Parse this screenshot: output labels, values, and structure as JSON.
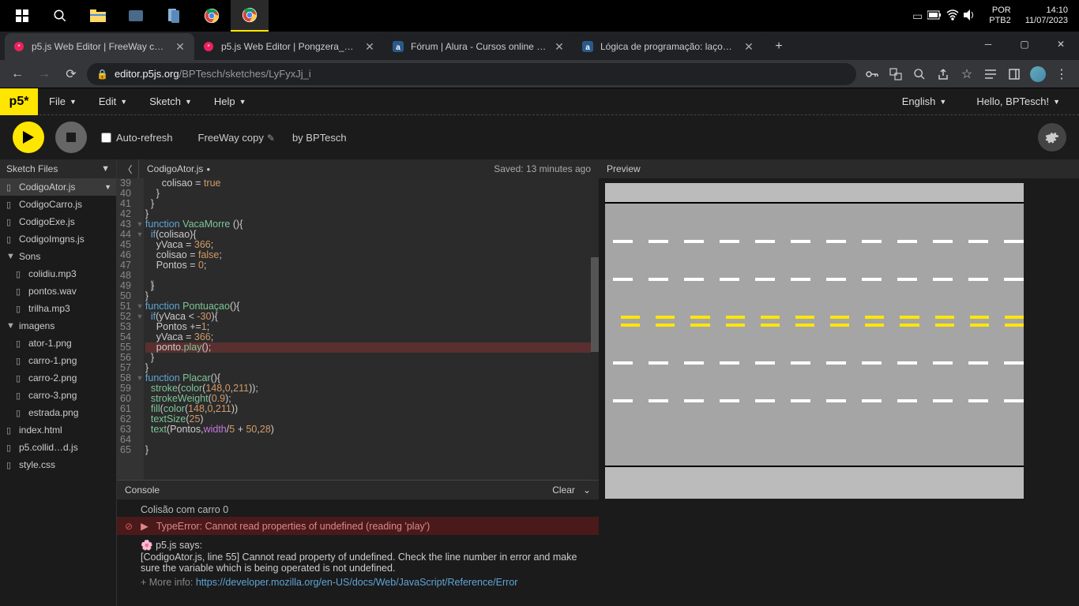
{
  "taskbar": {
    "lang1": "POR",
    "lang2": "PTB2",
    "time": "14:10",
    "date": "11/07/2023"
  },
  "tabs": [
    {
      "title": "p5.js Web Editor | FreeWay copy",
      "active": true
    },
    {
      "title": "p5.js Web Editor | Pongzera_Expe",
      "active": false
    },
    {
      "title": "Fórum | Alura - Cursos online de",
      "active": false
    },
    {
      "title": "Lógica de programação: laços e l",
      "active": false
    }
  ],
  "address": {
    "domain": "editor.p5js.org",
    "path": "/BPTesch/sketches/LyFyxJj_i"
  },
  "menu": {
    "file": "File",
    "edit": "Edit",
    "sketch": "Sketch",
    "help": "Help",
    "logo": "p5*",
    "english": "English",
    "hello": "Hello, BPTesch!"
  },
  "toolbar": {
    "auto_refresh": "Auto-refresh",
    "sketch_name": "FreeWay copy",
    "by": "by BPTesch"
  },
  "sidebar": {
    "header": "Sketch Files",
    "items": [
      {
        "name": "CodigoAtor.js",
        "icon": "▯",
        "indent": 0,
        "active": true,
        "arrow": true
      },
      {
        "name": "CodigoCarro.js",
        "icon": "▯",
        "indent": 0
      },
      {
        "name": "CodigoExe.js",
        "icon": "▯",
        "indent": 0
      },
      {
        "name": "CodigoImgns.js",
        "icon": "▯",
        "indent": 0
      },
      {
        "name": "Sons",
        "icon": "▼",
        "indent": 0
      },
      {
        "name": "colidiu.mp3",
        "icon": "▯",
        "indent": 1
      },
      {
        "name": "pontos.wav",
        "icon": "▯",
        "indent": 1
      },
      {
        "name": "trilha.mp3",
        "icon": "▯",
        "indent": 1
      },
      {
        "name": "imagens",
        "icon": "▼",
        "indent": 0
      },
      {
        "name": "ator-1.png",
        "icon": "▯",
        "indent": 1
      },
      {
        "name": "carro-1.png",
        "icon": "▯",
        "indent": 1
      },
      {
        "name": "carro-2.png",
        "icon": "▯",
        "indent": 1
      },
      {
        "name": "carro-3.png",
        "icon": "▯",
        "indent": 1
      },
      {
        "name": "estrada.png",
        "icon": "▯",
        "indent": 1
      },
      {
        "name": "index.html",
        "icon": "▯",
        "indent": 0
      },
      {
        "name": "p5.collid…d.js",
        "icon": "▯",
        "indent": 0
      },
      {
        "name": "style.css",
        "icon": "▯",
        "indent": 0
      }
    ]
  },
  "editor": {
    "filename": "CodigoAtor.js",
    "modified": "●",
    "saved": "Saved: 13 minutes ago",
    "first_line": 39,
    "lines": [
      {
        "html": "      colisao <span class='op'>=</span> <span class='bool'>true</span>"
      },
      {
        "html": "    }"
      },
      {
        "html": "  }"
      },
      {
        "html": "}"
      },
      {
        "html": "<span class='kw'>function</span> <span class='fn'>VacaMorre</span> (){",
        "fold": "▼"
      },
      {
        "html": "  <span class='kw'>if</span>(colisao){",
        "fold": "▼"
      },
      {
        "html": "    yVaca <span class='op'>=</span> <span class='num'>366</span>;"
      },
      {
        "html": "    colisao <span class='op'>=</span> <span class='bool'>false</span>;"
      },
      {
        "html": "    Pontos <span class='op'>=</span> <span class='num'>0</span>;"
      },
      {
        "html": ""
      },
      {
        "html": "  <span style='background:#444'>}</span>"
      },
      {
        "html": "}"
      },
      {
        "html": "<span class='kw'>function</span> <span class='fn'>Pontuaçao</span>(){",
        "fold": "▼"
      },
      {
        "html": "  <span class='kw'>if</span>(yVaca <span class='op'>&lt;</span> <span class='num'>-30</span>){",
        "fold": "▼"
      },
      {
        "html": "    Pontos <span class='op'>+=</span><span class='num'>1</span>;"
      },
      {
        "html": "    yVaca <span class='op'>=</span> <span class='num'>366</span>;"
      },
      {
        "html": "    ponto.<span class='fn'>play</span>();",
        "hl": true
      },
      {
        "html": "  }"
      },
      {
        "html": "}"
      },
      {
        "html": "<span class='kw'>function</span> <span class='fn'>Placar</span>(){",
        "fold": "▼"
      },
      {
        "html": "  <span class='fn'>stroke</span>(<span class='fn'>color</span>(<span class='num'>148</span>,<span class='num'>0</span>,<span class='num'>211</span>));"
      },
      {
        "html": "  <span class='fn'>strokeWeight</span>(<span class='num'>0.9</span>);"
      },
      {
        "html": "  <span class='fn'>fill</span>(<span class='fn'>color</span>(<span class='num'>148</span>,<span class='num'>0</span>,<span class='num'>211</span>))"
      },
      {
        "html": "  <span class='fn'>textSize</span>(<span class='num'>25</span>)"
      },
      {
        "html": "  <span class='fn'>text</span>(Pontos,<span class='prop'>width</span><span class='op'>/</span><span class='num'>5</span> <span class='op'>+</span> <span class='num'>50</span>,<span class='num'>28</span>)"
      },
      {
        "html": ""
      },
      {
        "html": "}"
      }
    ]
  },
  "console": {
    "title": "Console",
    "clear": "Clear",
    "log1": "Colisão com carro 0",
    "error": "TypeError: Cannot read properties of undefined (reading 'play')",
    "says_hdr": "p5.js says:",
    "says_body": "[CodigoAtor.js, line 55] Cannot read property of undefined. Check the line number in error and make sure the variable which is being operated is not undefined.",
    "more_label": "+ More info:",
    "more_url": "https://developer.mozilla.org/en-US/docs/Web/JavaScript/Reference/Error"
  },
  "preview": {
    "title": "Preview"
  }
}
